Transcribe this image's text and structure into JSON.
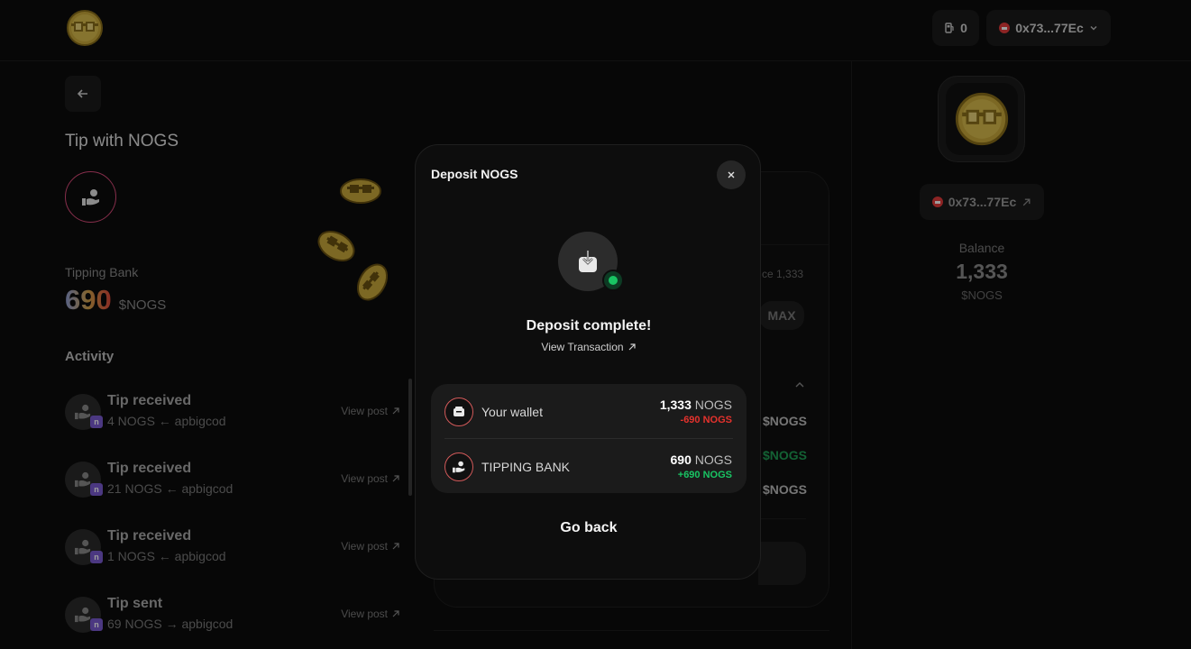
{
  "header": {
    "gas_count": "0",
    "wallet_address": "0x73...77Ec",
    "icons": {
      "logo": "nogs-coin-logo",
      "gas": "gas-pump-icon",
      "avatar": "noun-avatar-icon",
      "dropdown": "chevron-down-icon"
    }
  },
  "left": {
    "title": "Tip with NOGS",
    "bank_label": "Tipping Bank",
    "bank_amount": "690",
    "bank_unit": "$NOGS",
    "activity_title": "Activity",
    "activity": [
      {
        "title": "Tip received",
        "subtitle": "4 NOGS ← apbigcod",
        "link": "View post"
      },
      {
        "title": "Tip received",
        "subtitle": "21 NOGS ← apbigcod",
        "link": "View post"
      },
      {
        "title": "Tip received",
        "subtitle": "1 NOGS ← apbigcod",
        "link": "View post"
      },
      {
        "title": "Tip sent",
        "subtitle": "69 NOGS → apbigcod",
        "link": "View post"
      }
    ],
    "badge_letter": "n"
  },
  "middle": {
    "balance_fragment": "ce 1,333",
    "max_label": "MAX",
    "units": [
      "$NOGS",
      "$NOGS",
      "$NOGS"
    ],
    "unit_colors": [
      "#bdbdbd",
      "#1f9d55",
      "#bdbdbd"
    ]
  },
  "right": {
    "wallet_address": "0x73...77Ec",
    "balance_label": "Balance",
    "balance_value": "1,333",
    "balance_unit": "$NOGS"
  },
  "modal": {
    "title": "Deposit NOGS",
    "status": "Deposit complete!",
    "view_tx_label": "View Transaction",
    "rows": [
      {
        "label": "Your wallet",
        "amount": "1,333",
        "unit": "NOGS",
        "delta": "-690 NOGS",
        "delta_color": "#e5322d"
      },
      {
        "label": "TIPPING BANK",
        "amount": "690",
        "unit": "NOGS",
        "delta": "+690 NOGS",
        "delta_color": "#19c463"
      }
    ],
    "go_back_label": "Go back"
  },
  "colors": {
    "accent_green": "#19c463",
    "accent_red": "#e5322d",
    "background": "#0c0c0c"
  }
}
